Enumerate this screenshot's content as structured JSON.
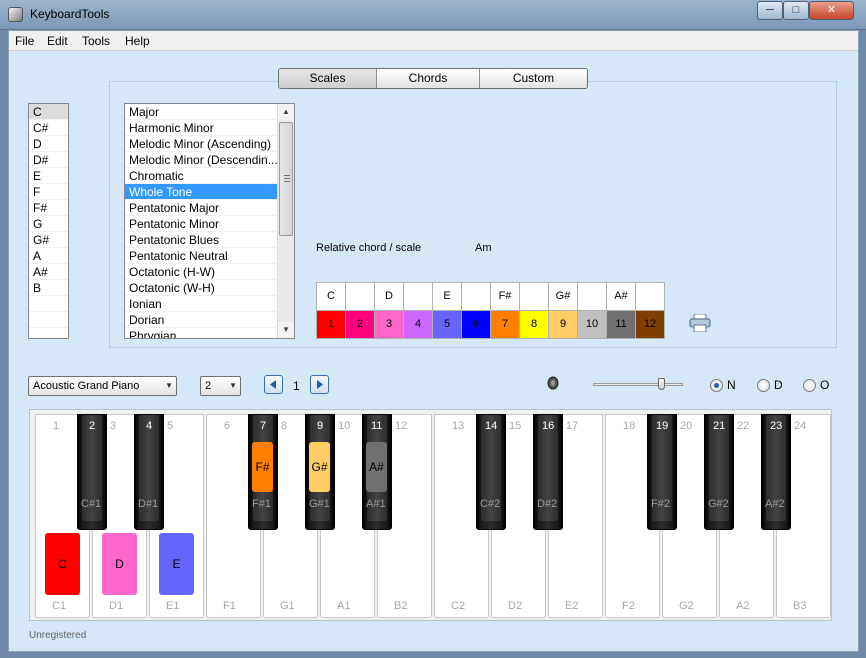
{
  "window": {
    "title": "KeyboardTools",
    "min": "─",
    "max": "□",
    "close": "✕"
  },
  "menu": [
    "File",
    "Edit",
    "Tools",
    "Help"
  ],
  "tabs": [
    "Scales",
    "Chords",
    "Custom"
  ],
  "roots": [
    "C",
    "C#",
    "D",
    "D#",
    "E",
    "F",
    "F#",
    "G",
    "G#",
    "A",
    "A#",
    "B"
  ],
  "scales": [
    "Major",
    "Harmonic Minor",
    "Melodic Minor (Ascending)",
    "Melodic Minor (Descendin...",
    "Chromatic",
    "Whole Tone",
    "Pentatonic Major",
    "Pentatonic Minor",
    "Pentatonic Blues",
    "Pentatonic Neutral",
    "Octatonic (H-W)",
    "Octatonic (W-H)",
    "Ionian",
    "Dorian",
    "Phrygian"
  ],
  "relative": {
    "label": "Relative chord / scale",
    "value": "Am"
  },
  "note_grid": {
    "top": [
      "C",
      "",
      "D",
      "",
      "E",
      "",
      "F#",
      "",
      "G#",
      "",
      "A#",
      ""
    ],
    "nums": [
      "1",
      "2",
      "3",
      "4",
      "5",
      "6",
      "7",
      "8",
      "9",
      "10",
      "11",
      "12"
    ],
    "colors": [
      "#ff0000",
      "#ff007f",
      "#ff66cc",
      "#cc66ff",
      "#6666ff",
      "#0000ff",
      "#ff7f00",
      "#ffff00",
      "#ffcc66",
      "#c0c0c0",
      "#707070",
      "#7f3f00"
    ]
  },
  "instrument": "Acoustic Grand Piano",
  "octaves": "2",
  "page": "1",
  "radios": [
    "N",
    "D",
    "O"
  ],
  "white_keys": [
    {
      "n": "1",
      "l": "C1"
    },
    {
      "n": "3",
      "l": "D1"
    },
    {
      "n": "5",
      "l": "E1"
    },
    {
      "n": "6",
      "l": "F1"
    },
    {
      "n": "8",
      "l": "G1"
    },
    {
      "n": "10",
      "l": "A1"
    },
    {
      "n": "12",
      "l": "B2"
    },
    {
      "n": "13",
      "l": "C2"
    },
    {
      "n": "15",
      "l": "D2"
    },
    {
      "n": "17",
      "l": "E2"
    },
    {
      "n": "18",
      "l": "F2"
    },
    {
      "n": "20",
      "l": "G2"
    },
    {
      "n": "22",
      "l": "A2"
    },
    {
      "n": "24",
      "l": "B3"
    }
  ],
  "black_keys": [
    {
      "n": "2",
      "l": "C#1"
    },
    {
      "n": "4",
      "l": "D#1"
    },
    {
      "n": "7",
      "l": "F#1"
    },
    {
      "n": "9",
      "l": "G#1"
    },
    {
      "n": "11",
      "l": "A#1"
    },
    {
      "n": "14",
      "l": "C#2"
    },
    {
      "n": "16",
      "l": "D#2"
    },
    {
      "n": "19",
      "l": "F#2"
    },
    {
      "n": "21",
      "l": "G#2"
    },
    {
      "n": "23",
      "l": "A#2"
    }
  ],
  "markers": [
    {
      "t": "C",
      "color": "#ff0000"
    },
    {
      "t": "D",
      "color": "#ff66cc"
    },
    {
      "t": "E",
      "color": "#6666ff"
    },
    {
      "t": "F#",
      "color": "#ff7f00"
    },
    {
      "t": "G#",
      "color": "#ffcc66"
    },
    {
      "t": "A#",
      "color": "#707070"
    }
  ],
  "status": "Unregistered"
}
